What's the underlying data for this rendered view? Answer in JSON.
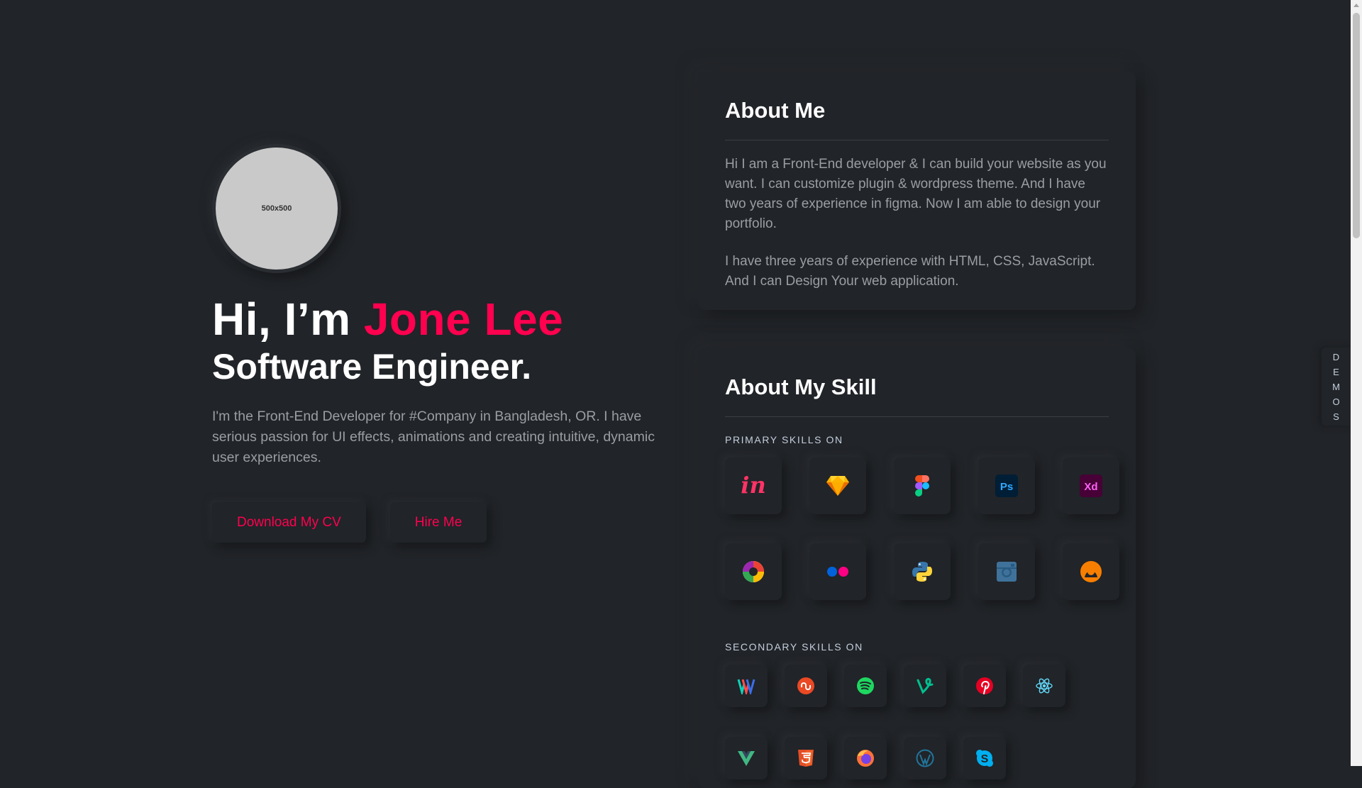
{
  "hero": {
    "avatar_placeholder": "500x500",
    "greeting": "Hi, I’m ",
    "name": "Jone Lee",
    "role": "Software Engineer.",
    "description": "I'm the Front-End Developer for #Company in Bangladesh, OR. I have serious passion for UI effects, animations and creating intuitive, dynamic user experiences.",
    "buttons": {
      "download_cv": "Download My CV",
      "hire_me": "Hire Me"
    }
  },
  "about": {
    "title": "About Me",
    "paragraphs": [
      "Hi I am a Front-End developer & I can build your website as you want. I can customize plugin & wordpress theme. And I have two years of experience in figma. Now I am able to design your portfolio.",
      "I have three years of experience with HTML, CSS, JavaScript. And I can Design Your web application."
    ]
  },
  "skills": {
    "title": "About My Skill",
    "primary_label": "PRIMARY SKILLS ON",
    "primary": [
      "invision-icon",
      "sketch-icon",
      "figma-icon",
      "photoshop-icon",
      "xd-icon",
      "picasa-icon",
      "flickr-icon",
      "python-icon",
      "instagram-icon",
      "grooveshark-icon"
    ],
    "secondary_label": "SECONDARY SKILLS ON",
    "secondary": [
      "wiki-icon",
      "stumbleupon-icon",
      "spotify-icon",
      "vine-icon",
      "pinterest-icon",
      "react-icon",
      "vuejs-icon",
      "html5-icon",
      "firefox-icon",
      "wordpress-icon",
      "skype-icon"
    ]
  },
  "demos": {
    "letters": [
      "D",
      "E",
      "M",
      "O",
      "S"
    ]
  },
  "colors": {
    "accent": "#ff014f",
    "background": "#212428",
    "text_muted": "#9a9ea3"
  }
}
